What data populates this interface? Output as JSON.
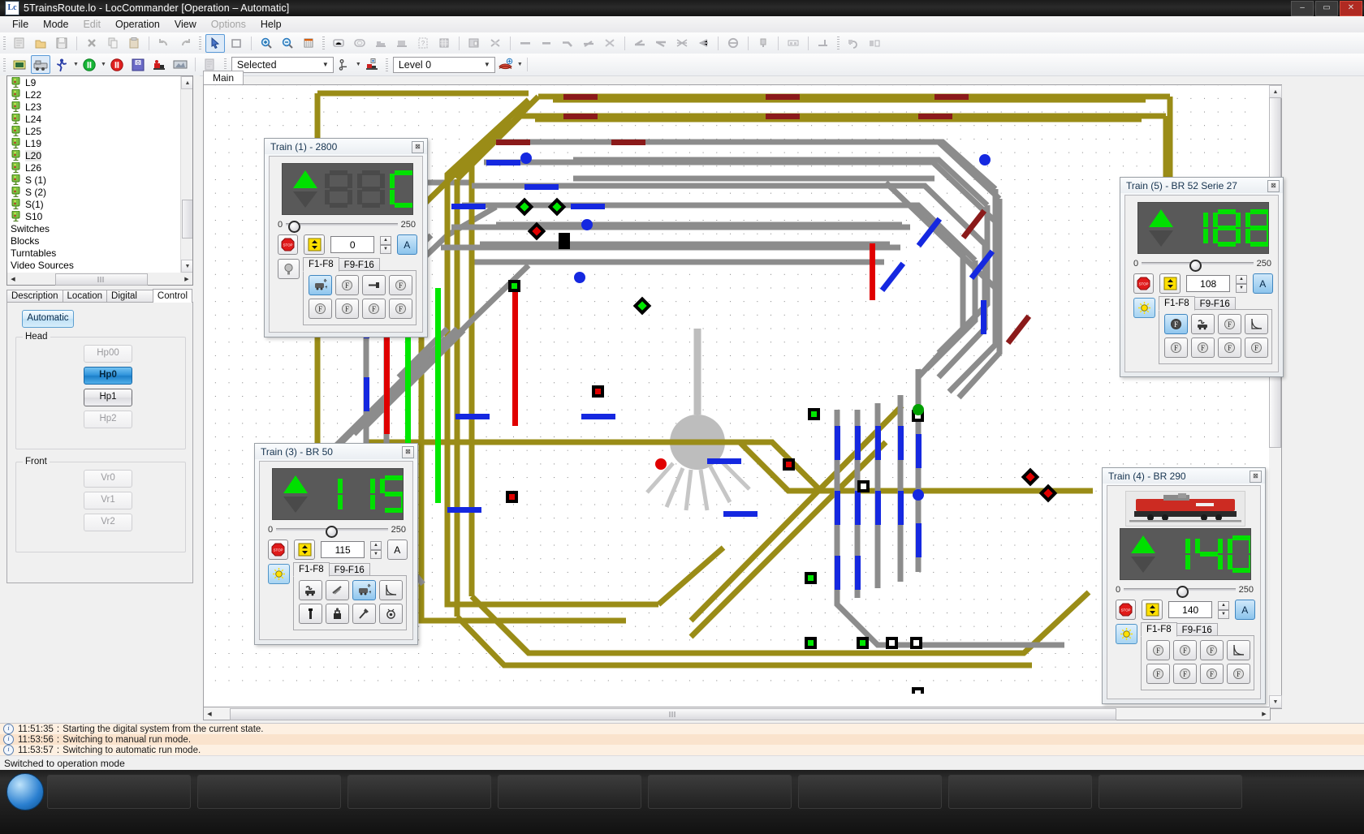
{
  "window": {
    "title": "5TrainsRoute.lo - LocCommander [Operation – Automatic]",
    "app_icon": "loc-icon",
    "minimize": "–",
    "maximize": "▭",
    "close": "✕"
  },
  "menubar": [
    {
      "label": "File",
      "enabled": true
    },
    {
      "label": "Mode",
      "enabled": true
    },
    {
      "label": "Edit",
      "enabled": false
    },
    {
      "label": "Operation",
      "enabled": true
    },
    {
      "label": "View",
      "enabled": true
    },
    {
      "label": "Options",
      "enabled": false
    },
    {
      "label": "Help",
      "enabled": true
    }
  ],
  "toolbar2": {
    "selection_combo": {
      "value": "Selected"
    },
    "level_combo": {
      "value": "Level 0"
    }
  },
  "sidebar": {
    "tree_items": [
      {
        "label": "L9",
        "icon": "signal-icon",
        "has_icon": true,
        "highlight": false
      },
      {
        "label": "L22",
        "icon": "signal-icon",
        "has_icon": true,
        "highlight": false
      },
      {
        "label": "L23",
        "icon": "signal-icon",
        "has_icon": true,
        "highlight": false
      },
      {
        "label": "L24",
        "icon": "signal-icon",
        "has_icon": true,
        "highlight": false
      },
      {
        "label": "L25",
        "icon": "signal-icon",
        "has_icon": true,
        "highlight": false
      },
      {
        "label": "L19",
        "icon": "signal-icon",
        "has_icon": true,
        "highlight": false
      },
      {
        "label": "L20",
        "icon": "signal-icon",
        "has_icon": true,
        "highlight": true
      },
      {
        "label": "L26",
        "icon": "signal-icon",
        "has_icon": true,
        "highlight": false
      },
      {
        "label": "S (1)",
        "icon": "signal-icon",
        "has_icon": true,
        "highlight": false
      },
      {
        "label": "S (2)",
        "icon": "signal-icon",
        "has_icon": true,
        "highlight": false
      },
      {
        "label": "S(1)",
        "icon": "signal-icon",
        "has_icon": true,
        "highlight": false
      },
      {
        "label": "S10",
        "icon": "signal-icon",
        "has_icon": true,
        "highlight": false
      },
      {
        "label": "Switches",
        "icon": "",
        "has_icon": false,
        "highlight": false
      },
      {
        "label": "Blocks",
        "icon": "",
        "has_icon": false,
        "highlight": false
      },
      {
        "label": "Turntables",
        "icon": "",
        "has_icon": false,
        "highlight": false
      },
      {
        "label": "Video Sources",
        "icon": "",
        "has_icon": false,
        "highlight": false
      }
    ],
    "tabs": [
      {
        "label": "Description",
        "active": false
      },
      {
        "label": "Location",
        "active": false
      },
      {
        "label": "Digital System",
        "active": false
      },
      {
        "label": "Control",
        "active": true
      }
    ],
    "control": {
      "automatic_label": "Automatic",
      "head_group": "Head",
      "head_buttons": [
        {
          "label": "Hp00",
          "state": "disabled"
        },
        {
          "label": "Hp0",
          "state": "on"
        },
        {
          "label": "Hp1",
          "state": "normal"
        },
        {
          "label": "Hp2",
          "state": "disabled"
        }
      ],
      "front_group": "Front",
      "front_buttons": [
        {
          "label": "Vr0",
          "state": "disabled"
        },
        {
          "label": "Vr1",
          "state": "disabled"
        },
        {
          "label": "Vr2",
          "state": "disabled"
        }
      ]
    }
  },
  "main": {
    "tabs": [
      {
        "label": "Main",
        "active": true
      }
    ]
  },
  "train_panels": [
    {
      "id": "train-1",
      "title": "Train (1) - 2800",
      "close": "⊠",
      "speed_display": "0",
      "lcd_digits": "  0",
      "direction": "forward",
      "slider_min": "0",
      "slider_max": "250",
      "slider_pct": 2,
      "speed_value": "0",
      "stop_label": "STOP",
      "auto_label": "A",
      "auto_active": true,
      "light_active": false,
      "light_icon": "headlight-icon",
      "fn_tabs": [
        {
          "label": "F1-F8",
          "active": true
        },
        {
          "label": "F9-F16",
          "active": false
        }
      ],
      "fn_buttons": [
        {
          "icon": "horn-plus-icon",
          "on": true
        },
        {
          "icon": "f-circle-icon",
          "on": false
        },
        {
          "icon": "coupler-icon",
          "on": false
        },
        {
          "icon": "f-circle-icon",
          "on": false
        },
        {
          "icon": "f-circle-icon",
          "on": false
        },
        {
          "icon": "f-circle-icon",
          "on": false
        },
        {
          "icon": "f-circle-icon",
          "on": false
        },
        {
          "icon": "f-circle-icon",
          "on": false
        }
      ],
      "has_loco_image": false
    },
    {
      "id": "train-5",
      "title": "Train (5) - BR 52 Serie 27",
      "close": "⊠",
      "lcd_digits": "108",
      "direction": "forward",
      "slider_min": "0",
      "slider_max": "250",
      "slider_pct": 43,
      "speed_value": "108",
      "stop_label": "STOP",
      "auto_label": "A",
      "auto_active": true,
      "light_active": true,
      "light_icon": "headlight-icon",
      "fn_tabs": [
        {
          "label": "F1-F8",
          "active": true
        },
        {
          "label": "F9-F16",
          "active": false
        }
      ],
      "fn_buttons": [
        {
          "icon": "f-circle-icon",
          "on": true
        },
        {
          "icon": "smoke-icon",
          "on": false
        },
        {
          "icon": "f-circle-icon",
          "on": false
        },
        {
          "icon": "curve-icon",
          "on": false
        },
        {
          "icon": "f-circle-icon",
          "on": false
        },
        {
          "icon": "f-circle-icon",
          "on": false
        },
        {
          "icon": "f-circle-icon",
          "on": false
        },
        {
          "icon": "f-circle-icon",
          "on": false
        }
      ],
      "has_loco_image": false
    },
    {
      "id": "train-3",
      "title": "Train (3) - BR 50",
      "close": "⊠",
      "lcd_digits": "115",
      "direction": "forward",
      "slider_min": "0",
      "slider_max": "250",
      "slider_pct": 44,
      "speed_value": "115",
      "stop_label": "STOP",
      "auto_label": "A",
      "auto_active": false,
      "light_active": true,
      "light_icon": "headlight-icon",
      "fn_tabs": [
        {
          "label": "F1-F8",
          "active": true
        },
        {
          "label": "F9-F16",
          "active": false
        }
      ],
      "fn_buttons": [
        {
          "icon": "smoke-icon",
          "on": false
        },
        {
          "icon": "rods-icon",
          "on": false
        },
        {
          "icon": "horn-plus-icon",
          "on": true
        },
        {
          "icon": "curve-icon",
          "on": false
        },
        {
          "icon": "lever-icon",
          "on": false
        },
        {
          "icon": "coal-icon",
          "on": false
        },
        {
          "icon": "shovel-icon",
          "on": false
        },
        {
          "icon": "whistle-icon",
          "on": false
        }
      ],
      "has_loco_image": false
    },
    {
      "id": "train-4",
      "title": "Train (4) - BR 290",
      "close": "⊠",
      "lcd_digits": "140",
      "direction": "forward",
      "slider_min": "0",
      "slider_max": "250",
      "slider_pct": 47,
      "speed_value": "140",
      "stop_label": "STOP",
      "auto_label": "A",
      "auto_active": true,
      "light_active": true,
      "light_icon": "headlight-icon",
      "fn_tabs": [
        {
          "label": "F1-F8",
          "active": true
        },
        {
          "label": "F9-F16",
          "active": false
        }
      ],
      "fn_buttons": [
        {
          "icon": "f-circle-icon",
          "on": false
        },
        {
          "icon": "f-circle-icon",
          "on": false
        },
        {
          "icon": "f-circle-icon",
          "on": false
        },
        {
          "icon": "curve-icon",
          "on": false
        },
        {
          "icon": "f-circle-icon",
          "on": false
        },
        {
          "icon": "f-circle-icon",
          "on": false
        },
        {
          "icon": "f-circle-icon",
          "on": false
        },
        {
          "icon": "f-circle-icon",
          "on": false
        }
      ],
      "has_loco_image": true,
      "loco_image_alt": "red diesel locomotive BR 290"
    }
  ],
  "log": [
    {
      "time": "11:51:35",
      "sep": ":",
      "text": "Starting the digital system from the current state."
    },
    {
      "time": "11:53:56",
      "sep": ":",
      "text": "Switching to manual run mode."
    },
    {
      "time": "11:53:57",
      "sep": ":",
      "text": "Switching to automatic run mode."
    }
  ],
  "statusbar": {
    "text": "Switched to operation mode"
  },
  "colors": {
    "lcd_green": "#00e000",
    "lcd_bg": "#595959",
    "route_yellow": "#9a8c17",
    "track_gray": "#8c8c8c",
    "occupied_red": "#e00000",
    "free_green": "#00e800",
    "sensor_blue": "#1528e0",
    "marker_darkred": "#8b1a1a",
    "accent_blue": "#2e92db",
    "log_bg": "#fdf0e2"
  }
}
